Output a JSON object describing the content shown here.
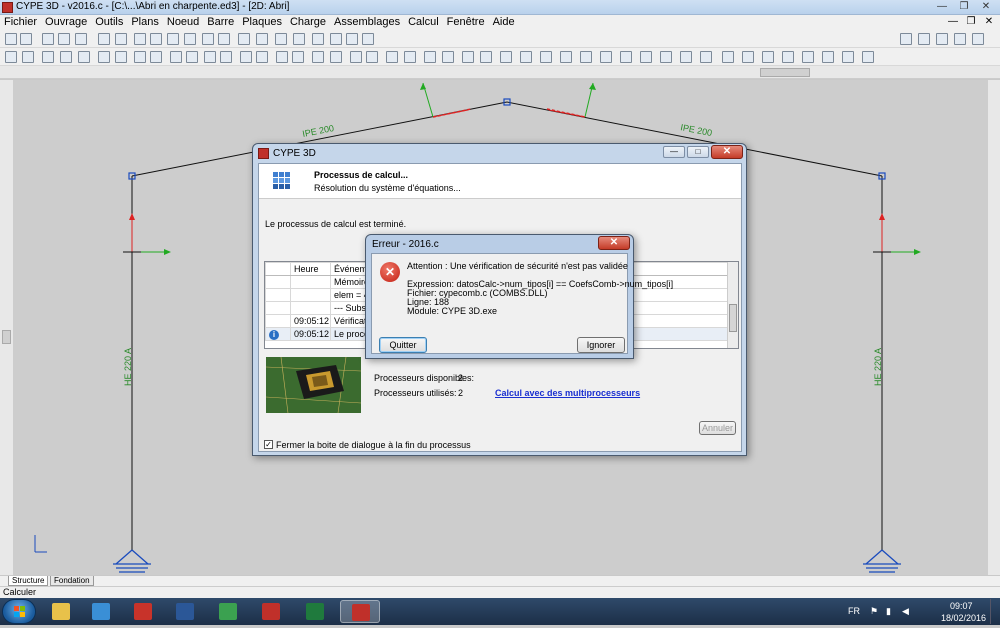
{
  "window": {
    "title": "CYPE 3D - v2016.c - [C:\\...\\Abri en charpente.ed3] - [2D: Abri]",
    "controls": [
      "—",
      "❐",
      "✕"
    ]
  },
  "menu": {
    "items": [
      "Fichier",
      "Ouvrage",
      "Outils",
      "Plans",
      "Noeud",
      "Barre",
      "Plaques",
      "Charge",
      "Assemblages",
      "Calcul",
      "Fenêtre",
      "Aide"
    ],
    "right_controls": [
      "—",
      "❐",
      "✕"
    ]
  },
  "drawing": {
    "beam_label_left": "IPE 200",
    "beam_label_right": "IPE 200",
    "column_label_left": "HE 220 A",
    "column_label_right": "HE 220 A"
  },
  "tabs": [
    "Structure",
    "Fondation"
  ],
  "status": {
    "text": "Calculer"
  },
  "process_dialog": {
    "title": "CYPE 3D",
    "header_title": "Processus de calcul...",
    "header_subtitle": "Résolution du système d'équations...",
    "message": "Le processus de calcul est terminé.",
    "columns": [
      "Heure",
      "Événement"
    ],
    "rows": [
      {
        "time": "",
        "event": "Mémoire m"
      },
      {
        "time": "",
        "event": "elem = 4 de"
      },
      {
        "time": "",
        "event": "--- Substitut"
      },
      {
        "time": "09:05:12",
        "event": "Vérification"
      },
      {
        "time": "09:05:12",
        "event": "Le process"
      }
    ],
    "proc_available_label": "Processeurs disponibles:",
    "proc_available_value": "2",
    "proc_used_label": "Processeurs utilisés:",
    "proc_used_value": "2",
    "multiproc_link": "Calcul avec des multiprocesseurs",
    "cancel_button": "Annuler",
    "close_checkbox_label": "Fermer la boite de dialogue à la fin du processus",
    "close_checkbox_checked": true
  },
  "error_dialog": {
    "title": "Erreur - 2016.c",
    "message": "Attention : Une vérification de sécurité n'est pas validée",
    "expression": "Expression: datosCalc->num_tipos[i] == CoefsComb->num_tipos[i]",
    "file": "Fichier: cypecomb.c (COMBS.DLL)",
    "line": "Ligne:    188",
    "module": "Module: CYPE 3D.exe",
    "quit_button": "Quitter",
    "ignore_button": "Ignorer"
  },
  "taskbar": {
    "apps": [
      {
        "name": "explorer",
        "color": "#e8c14a"
      },
      {
        "name": "media",
        "color": "#3a8fd6"
      },
      {
        "name": "acrobat",
        "color": "#c8332a"
      },
      {
        "name": "word",
        "color": "#2b5797"
      },
      {
        "name": "chrome",
        "color": "#3ba150"
      },
      {
        "name": "cype",
        "color": "#c0302a"
      },
      {
        "name": "excel",
        "color": "#1f7a3d"
      },
      {
        "name": "cype3d",
        "color": "#c0302a"
      }
    ],
    "lang": "FR",
    "time": "09:07",
    "date": "18/02/2016"
  }
}
